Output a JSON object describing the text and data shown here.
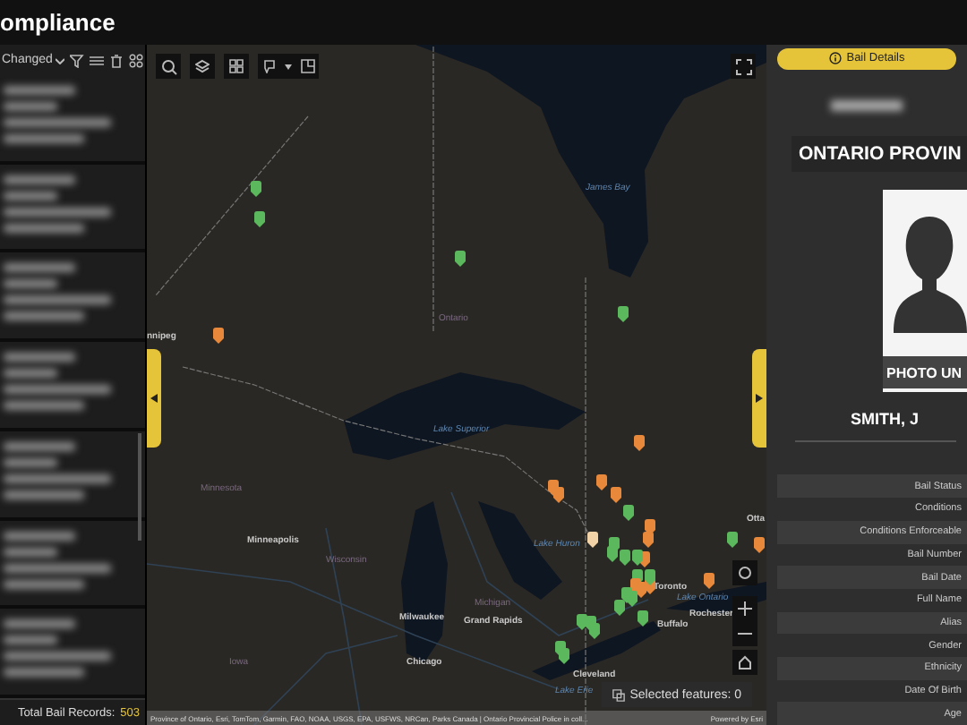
{
  "header": {
    "title": "ompliance"
  },
  "left_panel": {
    "sort_dropdown": {
      "value": "Changed"
    },
    "footer": {
      "label": "Total Bail Records:",
      "count": "503"
    }
  },
  "map": {
    "labels": [
      {
        "text": "James Bay",
        "kind": "water"
      },
      {
        "text": "Ontario",
        "kind": "region"
      },
      {
        "text": "nnipeg",
        "kind": "city"
      },
      {
        "text": "Lake Superior",
        "kind": "water"
      },
      {
        "text": "Minnesota",
        "kind": "region"
      },
      {
        "text": "Minneapolis",
        "kind": "city"
      },
      {
        "text": "Wisconsin",
        "kind": "region"
      },
      {
        "text": "Lake Huron",
        "kind": "water"
      },
      {
        "text": "Michigan",
        "kind": "region"
      },
      {
        "text": "Milwaukee",
        "kind": "city"
      },
      {
        "text": "Grand Rapids",
        "kind": "city"
      },
      {
        "text": "Chicago",
        "kind": "city"
      },
      {
        "text": "Iowa",
        "kind": "region"
      },
      {
        "text": "Toronto",
        "kind": "city"
      },
      {
        "text": "Lake Ontario",
        "kind": "water"
      },
      {
        "text": "Rochester",
        "kind": "city"
      },
      {
        "text": "Buffalo",
        "kind": "city"
      },
      {
        "text": "Cleveland",
        "kind": "city"
      },
      {
        "text": "Lake Erie",
        "kind": "water"
      },
      {
        "text": "Otta",
        "kind": "city"
      }
    ],
    "markers": [
      {
        "color": "#5cb85c"
      },
      {
        "color": "#5cb85c"
      },
      {
        "color": "#5cb85c"
      },
      {
        "color": "#5cb85c"
      },
      {
        "color": "#e8883a"
      },
      {
        "color": "#e8883a"
      },
      {
        "color": "#e8883a"
      },
      {
        "color": "#e8883a"
      },
      {
        "color": "#e8883a"
      },
      {
        "color": "#e8883a"
      },
      {
        "color": "#5cb85c"
      },
      {
        "color": "#f2d3a8"
      },
      {
        "color": "#e8883a"
      },
      {
        "color": "#e8883a"
      },
      {
        "color": "#5cb85c"
      },
      {
        "color": "#5cb85c"
      },
      {
        "color": "#e8883a"
      },
      {
        "color": "#5cb85c"
      },
      {
        "color": "#5cb85c"
      },
      {
        "color": "#5cb85c"
      },
      {
        "color": "#e8883a"
      },
      {
        "color": "#e8883a"
      },
      {
        "color": "#e8883a"
      },
      {
        "color": "#5cb85c"
      },
      {
        "color": "#e8883a"
      },
      {
        "color": "#5cb85c"
      },
      {
        "color": "#e8883a"
      },
      {
        "color": "#5cb85c"
      },
      {
        "color": "#5cb85c"
      },
      {
        "color": "#5cb85c"
      },
      {
        "color": "#5cb85c"
      },
      {
        "color": "#5cb85c"
      },
      {
        "color": "#5cb85c"
      },
      {
        "color": "#5cb85c"
      },
      {
        "color": "#5cb85c"
      },
      {
        "color": "#5cb85c"
      }
    ],
    "selected_features": "Selected features: 0",
    "attribution": "Province of Ontario, Esri, TomTom, Garmin, FAO, NOAA, USGS, EPA, USFWS, NRCan, Parks Canada | Ontario Provincial Police in coll...",
    "powered_by": "Powered by Esri"
  },
  "right_panel": {
    "details_button": "Bail Details",
    "agency": "ONTARIO PROVIN",
    "photo_caption": "PHOTO UN",
    "person_name": "SMITH, J",
    "fields": [
      "Bail Status",
      "Conditions",
      "Conditions Enforceable",
      "Bail Number",
      "Bail Date",
      "Full Name",
      "Alias",
      "Gender",
      "Ethnicity",
      "Date Of Birth",
      "Age"
    ]
  }
}
